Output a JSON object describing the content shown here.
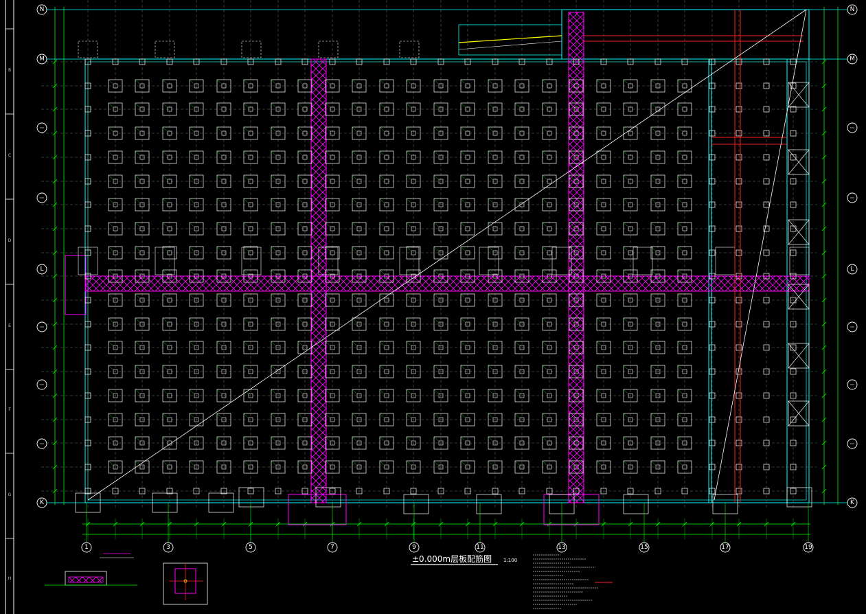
{
  "drawing": {
    "title": "±0.000m层板配筋图",
    "scale": "1:100",
    "border_letters": [
      "B",
      "C",
      "D",
      "E",
      "F",
      "G",
      "H"
    ],
    "grid_columns": [
      "1",
      "3",
      "5",
      "7",
      "9",
      "11",
      "13",
      "15",
      "17",
      "19"
    ],
    "grid_rows": [
      "N",
      "M",
      "L",
      "K"
    ],
    "colors": {
      "background": "#000000",
      "grid_axis": "#00ffff",
      "dimension": "#00ff00",
      "column": "#ffffff",
      "hatch_strip": "#ff00ff",
      "beam_red": "#ff2020",
      "yellow": "#ffff00",
      "border": "#ffffff"
    }
  }
}
